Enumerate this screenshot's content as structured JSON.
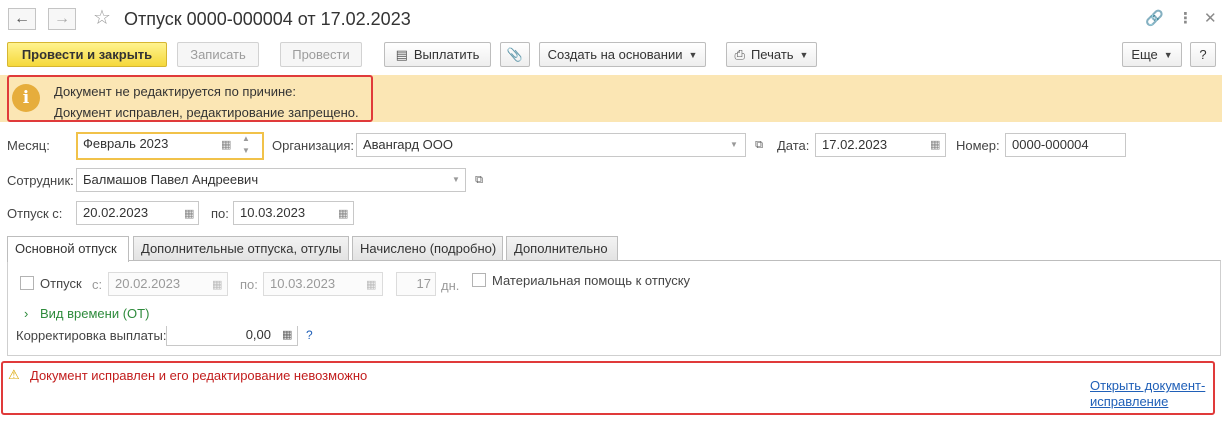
{
  "window": {
    "title": "Отпуск 0000-000004 от 17.02.2023",
    "icons": {
      "back": "arrow-left-icon",
      "forward": "arrow-right-icon",
      "favorite": "star-icon",
      "link": "link-icon",
      "more": "more-icon",
      "close": "close-icon"
    }
  },
  "toolbar": {
    "post_and_close": "Провести и закрыть",
    "write": "Записать",
    "post": "Провести",
    "pay": "Выплатить",
    "create_based": "Создать на основании",
    "print": "Печать",
    "more": "Еще",
    "help": "?"
  },
  "warning": {
    "line1": "Документ не редактируется по причине:",
    "line2": "Документ исправлен, редактирование запрещено.",
    "icon": "info-icon"
  },
  "form": {
    "month_label": "Месяц:",
    "month_value": "Февраль 2023",
    "org_label": "Организация:",
    "org_value": "Авангард ООО",
    "date_label": "Дата:",
    "date_value": "17.02.2023",
    "number_label": "Номер:",
    "number_value": "0000-000004",
    "employee_label": "Сотрудник:",
    "employee_value": "Балмашов Павел Андреевич",
    "vacation_from_label": "Отпуск с:",
    "vacation_from_value": "20.02.2023",
    "vacation_to_label": "по:",
    "vacation_to_value": "10.03.2023"
  },
  "tabs": [
    {
      "label": "Основной отпуск"
    },
    {
      "label": "Дополнительные отпуска, отгулы"
    },
    {
      "label": "Начислено (подробно)"
    },
    {
      "label": "Дополнительно"
    }
  ],
  "tab_main": {
    "vacation_check_label": "Отпуск",
    "from_label": "с:",
    "from_value": "20.02.2023",
    "to_label": "по:",
    "to_value": "10.03.2023",
    "days_value": "17",
    "days_label": "дн.",
    "material_help_label": "Материальная помощь к отпуску",
    "time_type_label": "Вид времени (ОТ)",
    "payment_correction_label": "Корректировка выплаты:",
    "payment_correction_value": "0,00",
    "help_mark": "?"
  },
  "footer": {
    "error_text": "Документ исправлен и его редактирование невозможно",
    "link_line1": "Открыть документ-",
    "link_line2": "исправление"
  },
  "colors": {
    "accent_yellow": "#f5d83b",
    "warning_bg": "#fbe6b4",
    "error_red": "#e03a3a",
    "link_blue": "#2060b8",
    "green": "#2e8b3c"
  }
}
